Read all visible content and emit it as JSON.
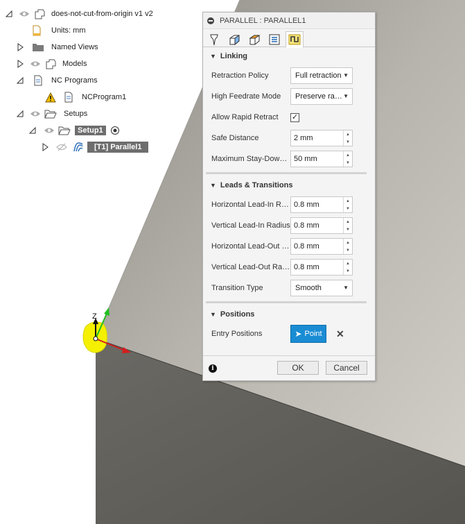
{
  "browser": {
    "root": {
      "label": "does-not-cut-from-origin v1 v2"
    },
    "units": {
      "label": "Units: mm"
    },
    "named_views": {
      "label": "Named Views"
    },
    "models": {
      "label": "Models"
    },
    "nc_programs": {
      "label": "NC Programs"
    },
    "nc_program1": {
      "label": "NCProgram1"
    },
    "setups": {
      "label": "Setups"
    },
    "setup1": {
      "label": "Setup1"
    },
    "parallel1": {
      "label": "[T1] Parallel1"
    }
  },
  "dialog": {
    "title": "PARALLEL : PARALLEL1",
    "tabs": [
      "tool-tab",
      "geometry-tab",
      "heights-tab",
      "passes-tab",
      "linking-tab"
    ],
    "active_tab": "linking-tab",
    "sections": {
      "linking": {
        "title": "Linking",
        "retraction_policy": {
          "label": "Retraction Policy",
          "value": "Full retraction"
        },
        "high_feedrate_mode": {
          "label": "High Feedrate Mode",
          "value": "Preserve rapid movement"
        },
        "allow_rapid_retract": {
          "label": "Allow Rapid Retract",
          "checked": true,
          "mark": "✓"
        },
        "safe_distance": {
          "label": "Safe Distance",
          "value": "2 mm"
        },
        "max_stay_down": {
          "label": "Maximum Stay-Down Distance",
          "value": "50 mm"
        }
      },
      "leads": {
        "title": "Leads & Transitions",
        "h_lead_in": {
          "label": "Horizontal Lead-In Radius",
          "value": "0.8 mm"
        },
        "v_lead_in": {
          "label": "Vertical Lead-In Radius",
          "value": "0.8 mm"
        },
        "h_lead_out": {
          "label": "Horizontal Lead-Out Radius",
          "value": "0.8 mm"
        },
        "v_lead_out": {
          "label": "Vertical Lead-Out Radius",
          "value": "0.8 mm"
        },
        "transition_type": {
          "label": "Transition Type",
          "value": "Smooth"
        }
      },
      "positions": {
        "title": "Positions",
        "entry_positions": {
          "label": "Entry Positions",
          "button": "Point"
        }
      }
    },
    "ok_label": "OK",
    "cancel_label": "Cancel"
  },
  "viewport": {
    "axis_label": "Z",
    "colors": {
      "face_light": "#bdbab3",
      "face_mid": "#8a8780",
      "face_dark": "#5d5b57",
      "origin_highlight": "#f4f000"
    }
  }
}
